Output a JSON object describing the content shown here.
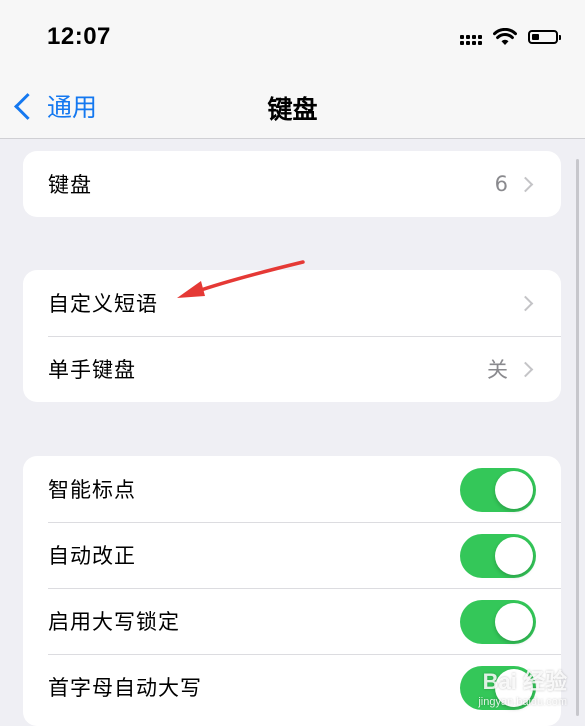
{
  "status_bar": {
    "time": "12:07",
    "battery_level": 0.3
  },
  "nav": {
    "back_label": "通用",
    "title": "键盘"
  },
  "groups": [
    {
      "rows": [
        {
          "label": "键盘",
          "value": "6",
          "accessory": "chevron"
        }
      ]
    },
    {
      "rows": [
        {
          "label": "自定义短语",
          "value": "",
          "accessory": "chevron"
        },
        {
          "label": "单手键盘",
          "value": "关",
          "accessory": "chevron"
        }
      ]
    },
    {
      "rows": [
        {
          "label": "智能标点",
          "accessory": "toggle",
          "on": true
        },
        {
          "label": "自动改正",
          "accessory": "toggle",
          "on": true
        },
        {
          "label": "启用大写锁定",
          "accessory": "toggle",
          "on": true
        },
        {
          "label": "首字母自动大写",
          "accessory": "toggle",
          "on": true
        }
      ]
    }
  ],
  "watermark": {
    "main": "Bai 经验",
    "sub": "jingyan.baidu.com"
  },
  "colors": {
    "accent": "#1478f0",
    "toggle_on": "#34c759",
    "annotation_arrow": "#e53935",
    "background": "#efeff4"
  }
}
